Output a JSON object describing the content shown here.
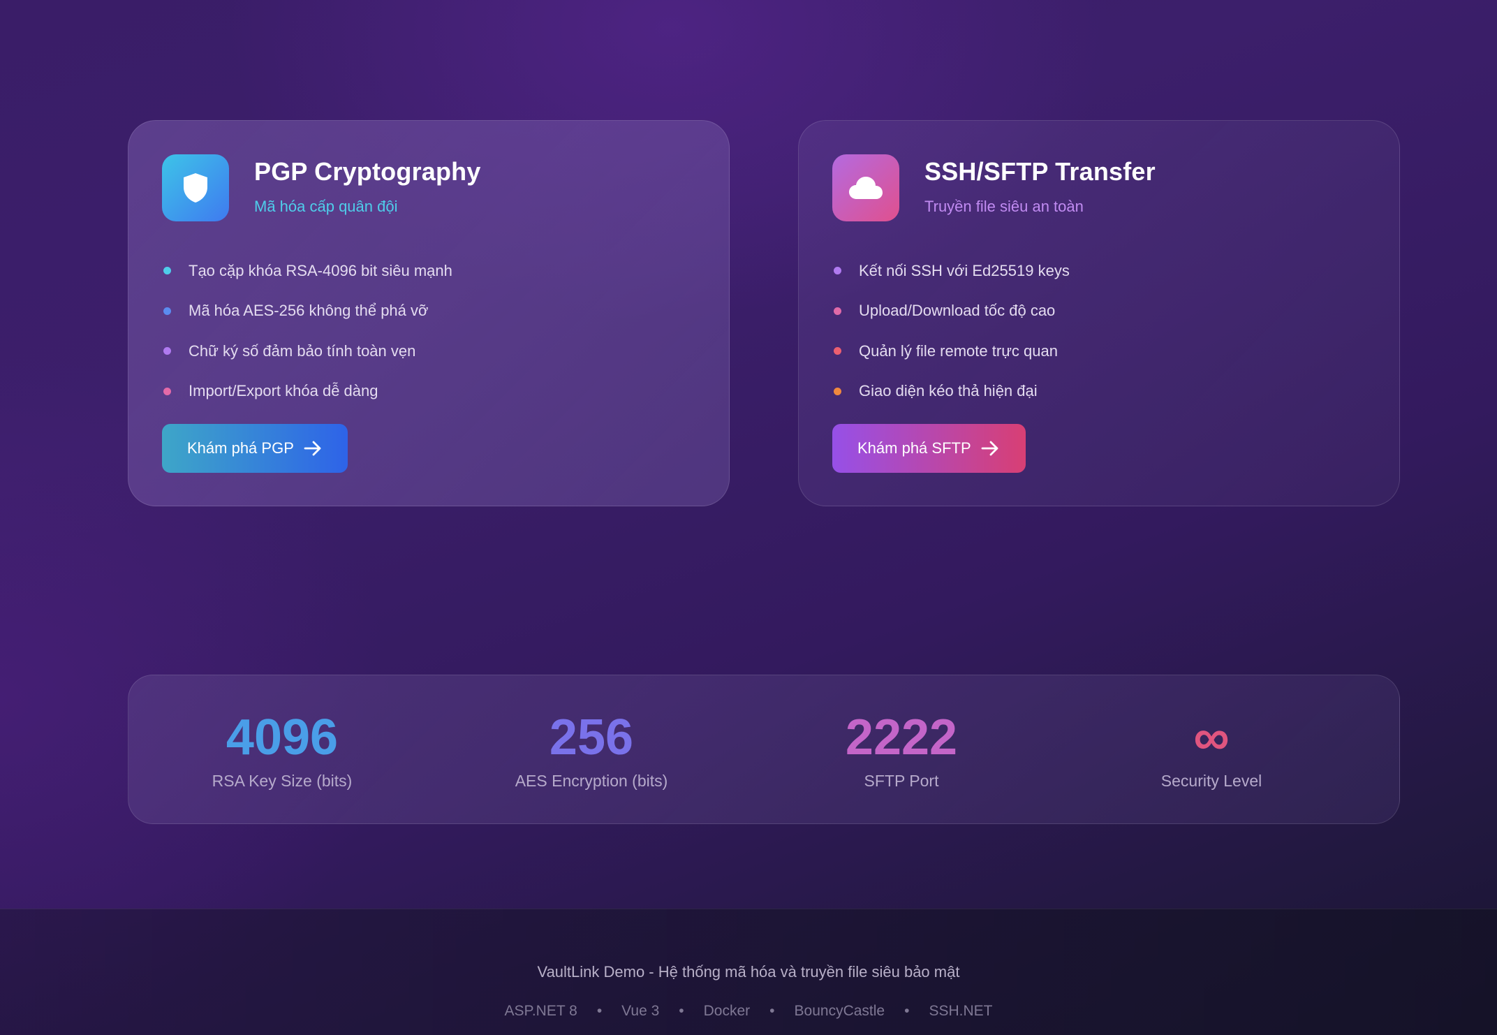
{
  "pgp": {
    "title": "PGP Cryptography",
    "subtitle": "Mã hóa cấp quân đội",
    "icon": "shield-icon",
    "features": [
      {
        "text": "Tạo cặp khóa RSA-4096 bit siêu mạnh",
        "color": "#4fcdea"
      },
      {
        "text": "Mã hóa AES-256 không thể phá vỡ",
        "color": "#5b8cf0"
      },
      {
        "text": "Chữ ký số đảm bảo tính toàn vẹn",
        "color": "#b07af0"
      },
      {
        "text": "Import/Export khóa dễ dàng",
        "color": "#e46aa8"
      }
    ],
    "button_label": "Khám phá PGP"
  },
  "sftp": {
    "title": "SSH/SFTP Transfer",
    "subtitle": "Truyền file siêu an toàn",
    "icon": "cloud-icon",
    "features": [
      {
        "text": "Kết nối SSH với Ed25519 keys",
        "color": "#b07af0"
      },
      {
        "text": "Upload/Download tốc độ cao",
        "color": "#e06aa8"
      },
      {
        "text": "Quản lý file remote trực quan",
        "color": "#ec5f70"
      },
      {
        "text": "Giao diện kéo thả hiện đại",
        "color": "#f0883e"
      }
    ],
    "button_label": "Khám phá SFTP"
  },
  "stats": [
    {
      "value": "4096",
      "label": "RSA Key Size (bits)"
    },
    {
      "value": "256",
      "label": "AES Encryption (bits)"
    },
    {
      "value": "2222",
      "label": "SFTP Port"
    },
    {
      "value": "∞",
      "label": "Security Level"
    }
  ],
  "footer": {
    "text": "VaultLink Demo - Hệ thống mã hóa và truyền file siêu bảo mật",
    "tech": [
      "ASP.NET 8",
      "Vue 3",
      "Docker",
      "BouncyCastle",
      "SSH.NET"
    ],
    "separator": "•"
  }
}
